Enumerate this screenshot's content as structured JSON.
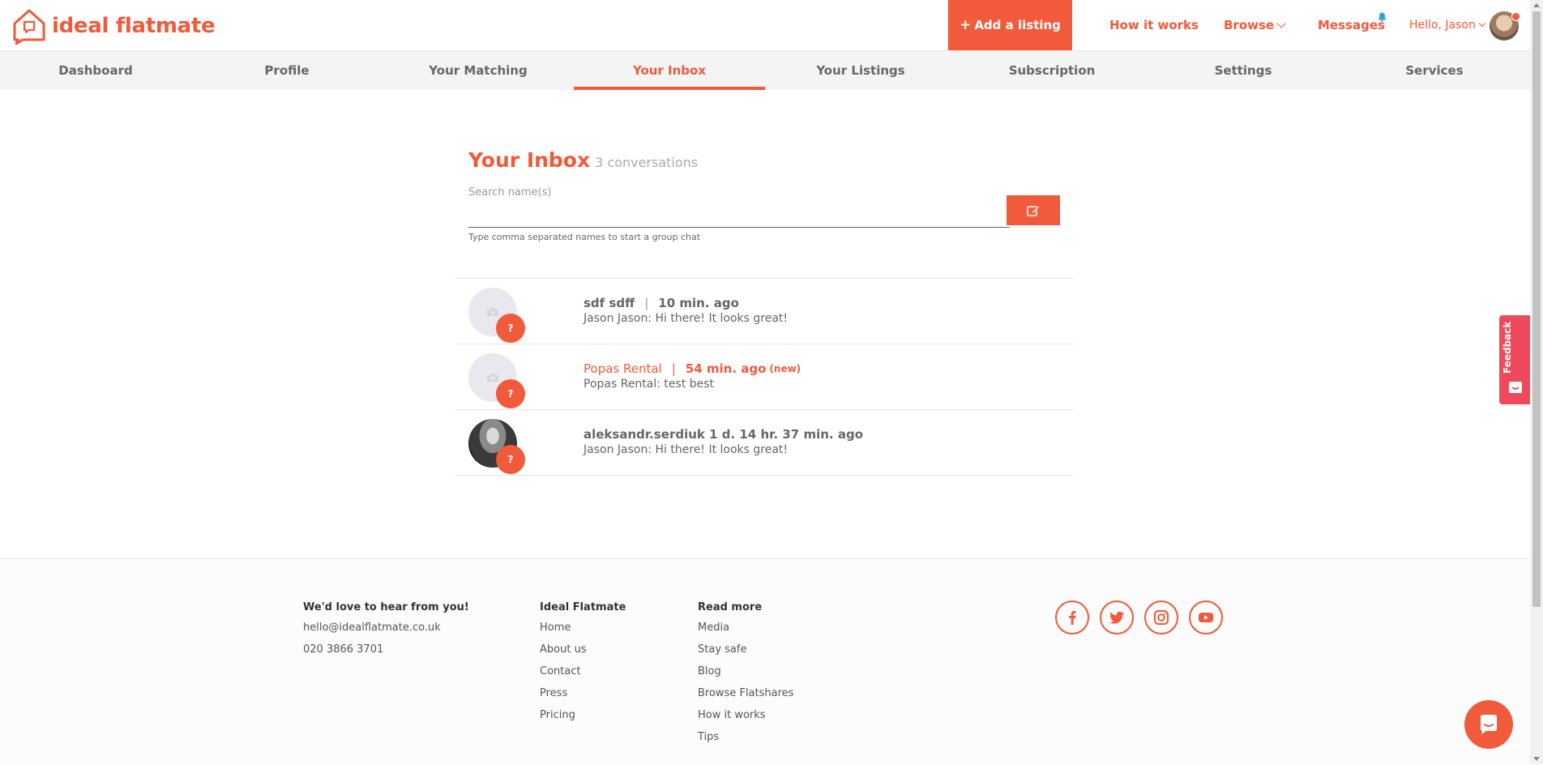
{
  "brand": {
    "name": "ideal flatmate",
    "accent": "#f15a3a"
  },
  "header": {
    "add_listing": "Add a listing",
    "how_it_works": "How it works",
    "browse": "Browse",
    "messages": "Messages",
    "greeting": "Hello, Jason"
  },
  "tabs": [
    {
      "label": "Dashboard"
    },
    {
      "label": "Profile"
    },
    {
      "label": "Your Matching"
    },
    {
      "label": "Your Inbox",
      "active": true
    },
    {
      "label": "Your Listings"
    },
    {
      "label": "Subscription"
    },
    {
      "label": "Settings"
    },
    {
      "label": "Services"
    }
  ],
  "inbox": {
    "title": "Your Inbox",
    "count": "3 conversations",
    "search_label": "Search name(s)",
    "search_value": "",
    "hint": "Type comma separated names to start a group chat",
    "conversations": [
      {
        "name": "sdf sdff",
        "separator": "|",
        "time": "10 min. ago",
        "new_label": "",
        "preview": "Jason Jason: Hi there! It looks great!",
        "badge": "?",
        "unread": false
      },
      {
        "name": "Popas Rental",
        "separator": "|",
        "time": "54 min. ago",
        "new_label": "(new)",
        "preview": "Popas Rental: test best",
        "badge": "?",
        "unread": true
      },
      {
        "name": "aleksandr.serdiuk 1 d. 14 hr. 37 min. ago",
        "separator": "",
        "time": "",
        "new_label": "",
        "preview": "Jason Jason: Hi there! It looks great!",
        "badge": "?",
        "unread": false
      }
    ]
  },
  "feedback": {
    "label": "Feedback"
  },
  "footer": {
    "contact": {
      "heading": "We'd love to hear from you!",
      "email": "hello@idealflatmate.co.uk",
      "phone": "020 3866 3701"
    },
    "ideal_flatmate": {
      "heading": "Ideal Flatmate",
      "links": [
        "Home",
        "About us",
        "Contact",
        "Press",
        "Pricing"
      ]
    },
    "read_more": {
      "heading": "Read more",
      "links": [
        "Media",
        "Stay safe",
        "Blog",
        "Browse Flatshares",
        "How it works",
        "Tips"
      ]
    },
    "social": [
      "facebook-icon",
      "twitter-icon",
      "instagram-icon",
      "youtube-icon"
    ]
  }
}
